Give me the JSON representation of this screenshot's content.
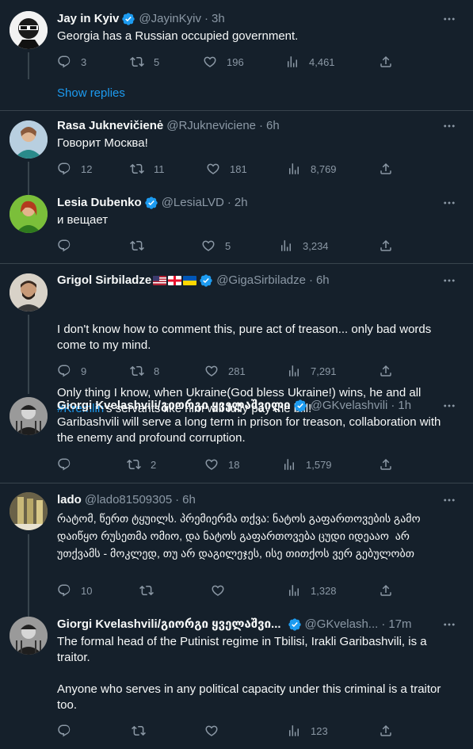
{
  "tweets": [
    {
      "name": "Jay in Kyiv",
      "handle": "@JayinKyiv",
      "time": "3h",
      "text": "Georgia has a Russian occupied government.",
      "replies": "3",
      "retweets": "5",
      "likes": "196",
      "views": "4,461",
      "show_replies": "Show replies"
    },
    {
      "name": "Rasa Juknevičienė",
      "handle": "@RJukneviciene",
      "time": "6h",
      "text": "Говорит Москва!",
      "replies": "12",
      "retweets": "11",
      "likes": "181",
      "views": "8,769"
    },
    {
      "name": "Lesia Dubenko",
      "handle": "@LesiaLVD",
      "time": "2h",
      "text": "и вещает",
      "replies": "",
      "retweets": "",
      "likes": "5",
      "views": "3,234"
    },
    {
      "name": "Grigol Sirbiladze",
      "handle": "@GigaSirbiladze",
      "time": "6h",
      "text_line1": "I don't know how to comment this, pure act of treason... only bad words come to my mind.",
      "text_line2": "Only thing I know, when Ukraine(God bless Ukraine!) wins, he and all",
      "hashtag": "#Kremlin",
      "text_line3": "'s servants like him will fully pay the bill!",
      "replies": "9",
      "retweets": "8",
      "likes": "281",
      "views": "7,291"
    },
    {
      "name": "Giorgi Kvelashvili/გიორგი ყველაშვილი",
      "handle": "@GKvelashvili",
      "time": "1h",
      "text": "Garibashvili will serve a long term in prison for treason, collaboration with the enemy and profound corruption.",
      "replies": "",
      "retweets": "2",
      "likes": "18",
      "views": "1,579"
    },
    {
      "name": "lado",
      "handle": "@lado81509305",
      "time": "6h",
      "text": "რატომ, წერთ ტყუილს. პრემიერმა თქვა: ნატოს გაფართოვების გამო დაიწყო რუსეთმა ომიო, და ნატოს გაფართოვება ცუდი იდეააო  არ უთქვამს - მოკლედ, თუ არ დაგილეჯეს, ისე თითქოს ვერ გებულობთ",
      "replies": "10",
      "retweets": "",
      "likes": "",
      "views": "1,328"
    },
    {
      "name": "Giorgi Kvelashvili/გიორგი ყველაშვი...",
      "handle": "@GKvelash...",
      "time": "17m",
      "text": "The formal head of the Putinist regime in Tbilisi, Irakli Garibashvili, is a traitor.\n\nAnyone who serves in any political capacity under this criminal is a traitor too.",
      "replies": "",
      "retweets": "",
      "likes": "",
      "views": "123"
    }
  ],
  "colors": {
    "background": "#15202b",
    "accent": "#1d9bf0",
    "muted": "#8b98a5",
    "divider": "#38444d"
  }
}
